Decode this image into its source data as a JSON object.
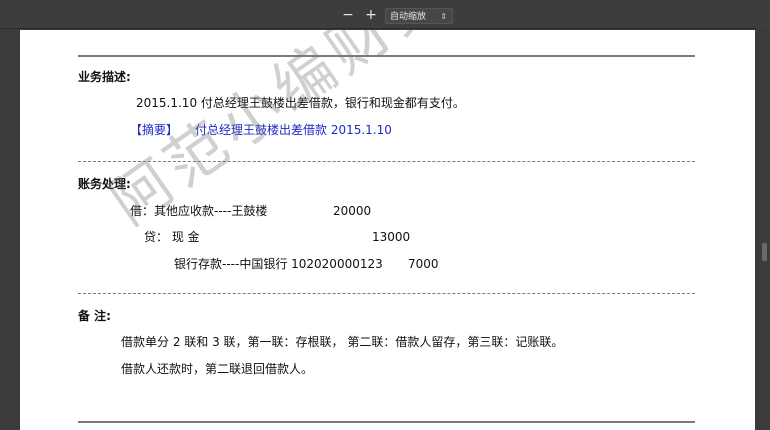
{
  "toolbar": {
    "zoom_out_label": "−",
    "zoom_in_label": "+",
    "zoom_select_value": "自动缩放"
  },
  "document": {
    "business_heading": "业务描述:",
    "business_text": "2015.1.10 付总经理王鼓楼出差借款，银行和现金都有支付。",
    "summary_label": "【摘要】",
    "summary_text": "付总经理王鼓楼出差借款 2015.1.10",
    "accounting_heading": "账务处理:",
    "debit_line": {
      "account": "借：其他应收款----王鼓楼",
      "amount": "20000"
    },
    "credit_line_1": {
      "account": "贷：   现    金",
      "amount": "13000"
    },
    "credit_line_2": {
      "account": "银行存款----中国银行 102020000123",
      "amount": "7000"
    },
    "notes_heading": "备      注:",
    "notes_line_1": "借款单分 2 联和 3 联，第一联：存根联，   第二联：借款人留存，第三联：记账联。",
    "notes_line_2": "借款人还款时，第二联退回借款人。",
    "watermark": "阿范小编财务"
  },
  "colors": {
    "summary_blue": "#1f2ac7",
    "toolbar_bg": "#3d3d3d",
    "page_bg": "#ffffff"
  }
}
